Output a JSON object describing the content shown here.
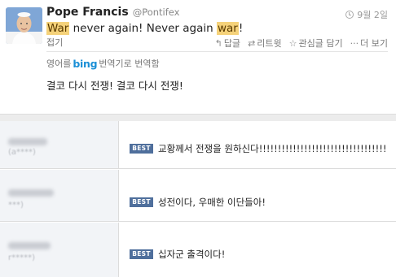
{
  "tweet": {
    "author_name": "Pope Francis",
    "author_handle": "@Pontifex",
    "date": "9월 2일",
    "text_parts": {
      "w1": "War",
      "t1": " never again! Never again ",
      "w2": "war",
      "t2": "!"
    },
    "collapse_label": "접기",
    "actions": {
      "reply": "답글",
      "retweet": "리트윗",
      "favorite": "관심글 담기",
      "more": "더 보기"
    },
    "translate": {
      "prefix": "영어를",
      "brand": "bing",
      "suffix": "번역기로 번역함"
    },
    "translated_text": "결코 다시 전쟁! 결코 다시 전쟁!"
  },
  "comments": [
    {
      "badge": "BEST",
      "text": "교황께서 전쟁을 원하신다!!!!!!!!!!!!!!!!!!!!!!!!!!!!!!!!!!",
      "meta": "(a****)"
    },
    {
      "badge": "BEST",
      "text": "성전이다, 우매한 이단들아!",
      "meta": "***)"
    },
    {
      "badge": "BEST",
      "text": "십자군 출격이다!",
      "meta": "r*****)"
    }
  ],
  "colors": {
    "highlight": "#f5d27a",
    "best_badge": "#4f6f9c",
    "bing_blue": "#1b8fd6"
  }
}
